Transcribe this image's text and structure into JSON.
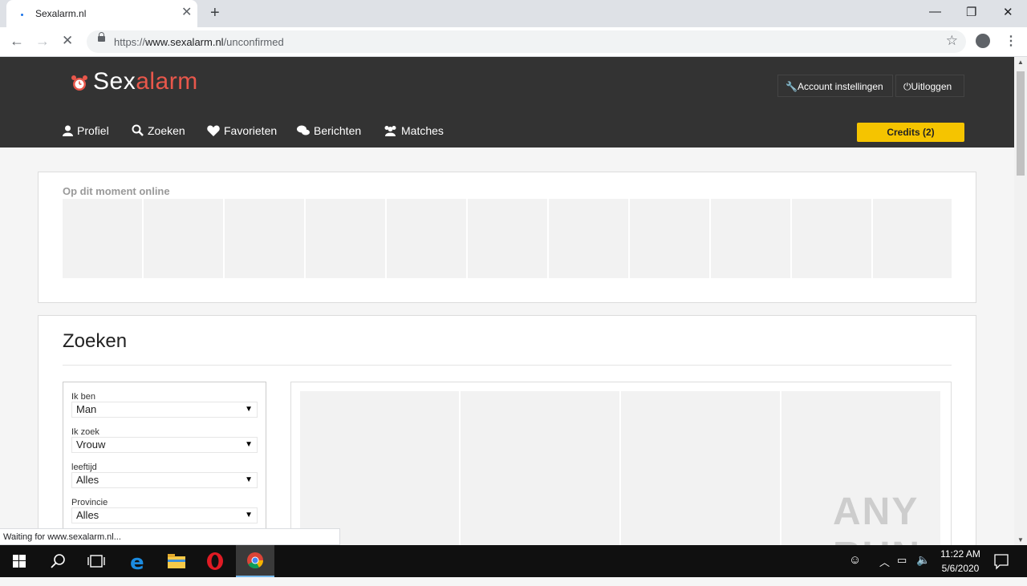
{
  "browser": {
    "tab_title": "Sexalarm.nl",
    "tab_close": "✕",
    "new_tab": "+",
    "url_scheme": "https://",
    "url_host": "www.sexalarm.nl",
    "url_path": "/unconfirmed",
    "status_text": "Waiting for www.sexalarm.nl..."
  },
  "site": {
    "logo_plain": "Sex",
    "logo_accent": "alarm",
    "account_settings": "Account instellingen",
    "logout": "Uitloggen",
    "menu": [
      "Profiel",
      "Zoeken",
      "Favorieten",
      "Berichten",
      "Matches"
    ],
    "credits": "Credits (2)"
  },
  "online": {
    "title": "Op dit moment online"
  },
  "search": {
    "title": "Zoeken",
    "filters": [
      {
        "label": "Ik ben",
        "value": "Man"
      },
      {
        "label": "Ik zoek",
        "value": "Vrouw"
      },
      {
        "label": "leeftijd",
        "value": "Alles"
      },
      {
        "label": "Provincie",
        "value": "Alles"
      }
    ]
  },
  "watermark": "ANY RUN",
  "taskbar": {
    "time": "11:22 AM",
    "date": "5/6/2020"
  },
  "colors": {
    "header_bg": "#333333",
    "logo_accent": "#e8574b",
    "credits_bg": "#f5c400"
  }
}
